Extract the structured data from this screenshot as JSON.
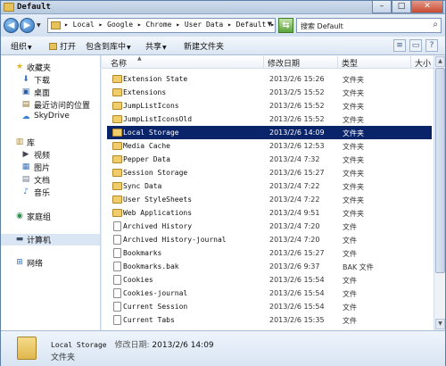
{
  "window": {
    "title": "Default"
  },
  "address": {
    "path": "▸ Local ▸ Google ▸ Chrome ▸ User Data ▸ Default ▸",
    "search_placeholder": "搜索 Default"
  },
  "toolbar": {
    "organize": "组织",
    "open": "打开",
    "include_in_library": "包含到库中",
    "share": "共享",
    "new_folder": "新建文件夹"
  },
  "nav": {
    "favorites": "收藏夹",
    "downloads": "下载",
    "desktop": "桌面",
    "recent": "最近访问的位置",
    "skydrive": "SkyDrive",
    "libraries": "库",
    "videos": "视频",
    "pictures": "图片",
    "documents": "文档",
    "music": "音乐",
    "homegroup": "家庭组",
    "computer": "计算机",
    "network": "网络"
  },
  "columns": {
    "name": "名称",
    "modified": "修改日期",
    "type": "类型",
    "size": "大小"
  },
  "files": [
    {
      "name": "Extension State",
      "date": "2013/2/6 15:26",
      "type": "文件夹",
      "kind": "folder"
    },
    {
      "name": "Extensions",
      "date": "2013/2/5 15:52",
      "type": "文件夹",
      "kind": "folder"
    },
    {
      "name": "JumpListIcons",
      "date": "2013/2/6 15:52",
      "type": "文件夹",
      "kind": "folder"
    },
    {
      "name": "JumpListIconsOld",
      "date": "2013/2/6 15:52",
      "type": "文件夹",
      "kind": "folder"
    },
    {
      "name": "Local Storage",
      "date": "2013/2/6 14:09",
      "type": "文件夹",
      "kind": "folder"
    },
    {
      "name": "Media Cache",
      "date": "2013/2/6 12:53",
      "type": "文件夹",
      "kind": "folder"
    },
    {
      "name": "Pepper Data",
      "date": "2013/2/4 7:32",
      "type": "文件夹",
      "kind": "folder"
    },
    {
      "name": "Session Storage",
      "date": "2013/2/6 15:27",
      "type": "文件夹",
      "kind": "folder"
    },
    {
      "name": "Sync Data",
      "date": "2013/2/4 7:22",
      "type": "文件夹",
      "kind": "folder"
    },
    {
      "name": "User StyleSheets",
      "date": "2013/2/4 7:22",
      "type": "文件夹",
      "kind": "folder"
    },
    {
      "name": "Web Applications",
      "date": "2013/2/4 9:51",
      "type": "文件夹",
      "kind": "folder"
    },
    {
      "name": "Archived History",
      "date": "2013/2/4 7:20",
      "type": "文件",
      "kind": "file"
    },
    {
      "name": "Archived History-journal",
      "date": "2013/2/4 7:20",
      "type": "文件",
      "kind": "file"
    },
    {
      "name": "Bookmarks",
      "date": "2013/2/6 15:27",
      "type": "文件",
      "kind": "file"
    },
    {
      "name": "Bookmarks.bak",
      "date": "2013/2/6 9:37",
      "type": "BAK 文件",
      "kind": "file"
    },
    {
      "name": "Cookies",
      "date": "2013/2/6 15:54",
      "type": "文件",
      "kind": "file"
    },
    {
      "name": "Cookies-journal",
      "date": "2013/2/6 15:54",
      "type": "文件",
      "kind": "file"
    },
    {
      "name": "Current Session",
      "date": "2013/2/6 15:54",
      "type": "文件",
      "kind": "file"
    },
    {
      "name": "Current Tabs",
      "date": "2013/2/6 15:35",
      "type": "文件",
      "kind": "file"
    }
  ],
  "selected_index": 4,
  "details": {
    "name": "Local Storage",
    "modified_label": "修改日期:",
    "modified": "2013/2/6 14:09",
    "type": "文件夹"
  }
}
